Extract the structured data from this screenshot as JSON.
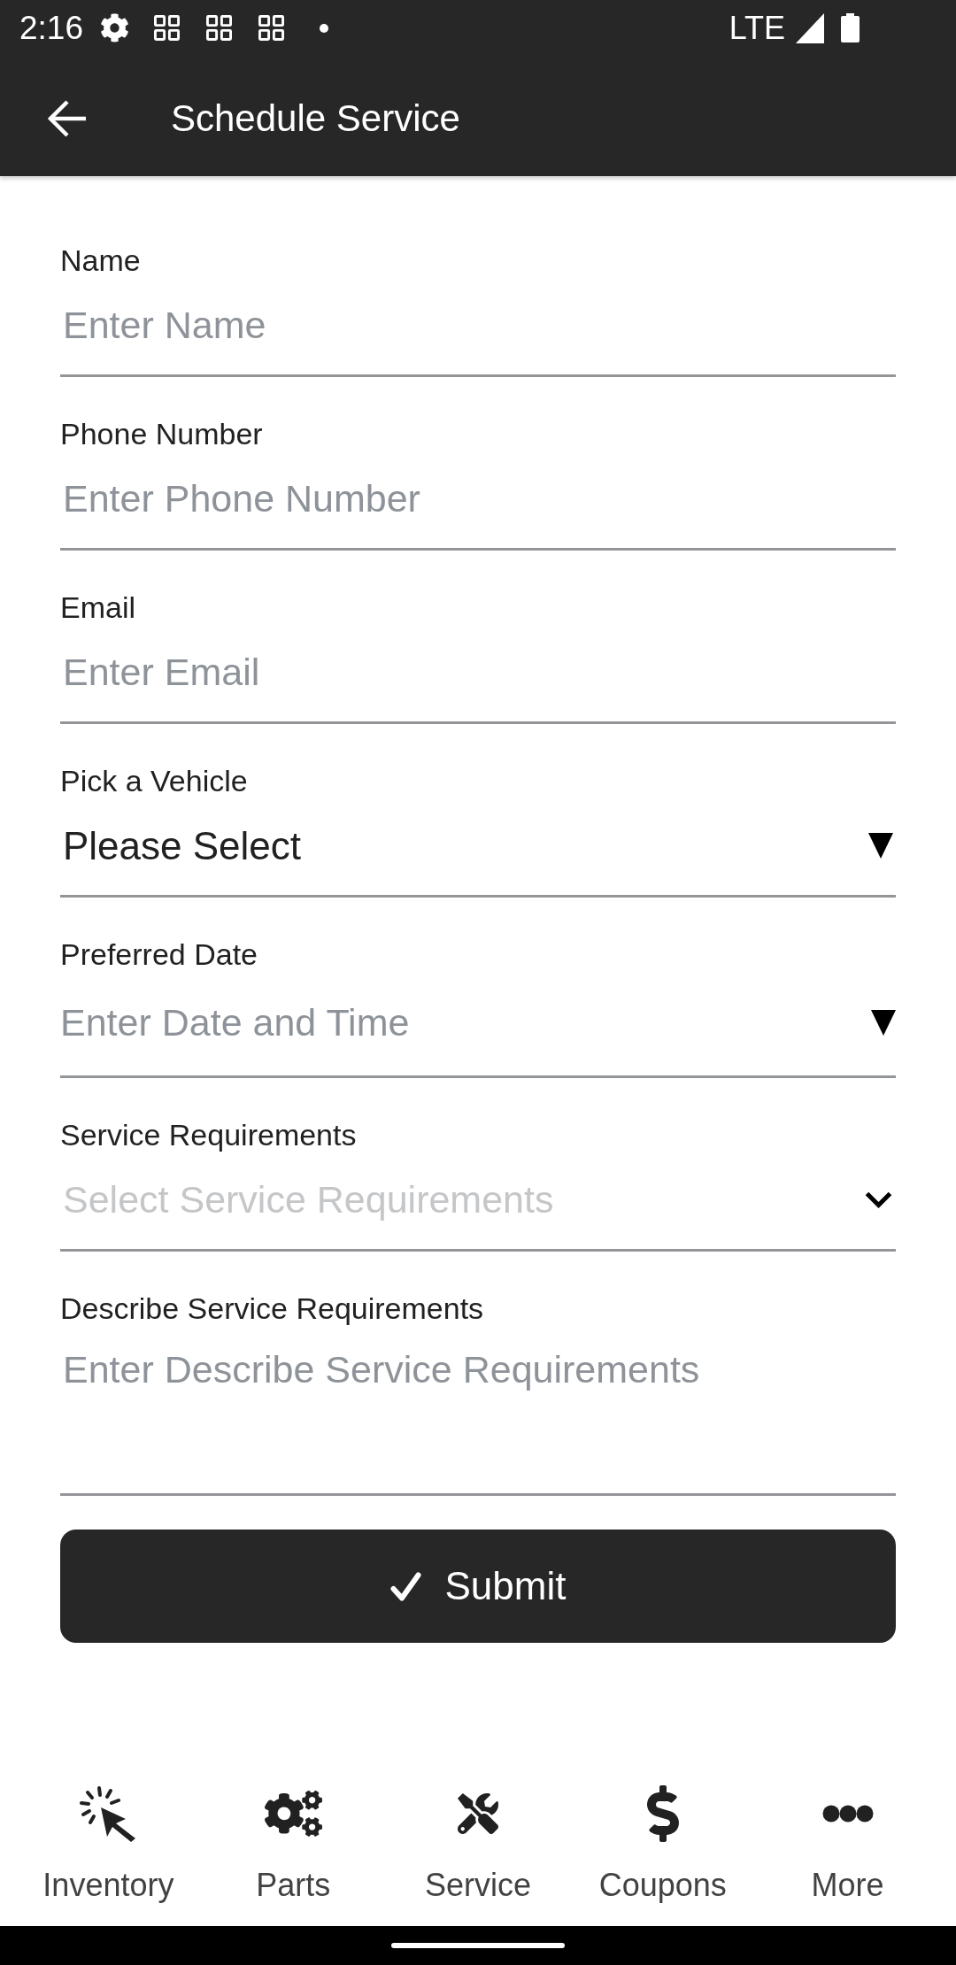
{
  "status_bar": {
    "time": "2:16",
    "network": "LTE"
  },
  "app_bar": {
    "title": "Schedule Service"
  },
  "form": {
    "fields": [
      {
        "kind": "text",
        "label": "Name",
        "placeholder": "Enter Name"
      },
      {
        "kind": "text",
        "label": "Phone Number",
        "placeholder": "Enter Phone Number"
      },
      {
        "kind": "text",
        "label": "Email",
        "placeholder": "Enter Email"
      },
      {
        "kind": "select",
        "label": "Pick a Vehicle",
        "value": "Please Select"
      },
      {
        "kind": "datetime",
        "label": "Preferred Date",
        "placeholder": "Enter Date and Time"
      },
      {
        "kind": "multiselect",
        "label": "Service Requirements",
        "placeholder": "Select Service Requirements"
      },
      {
        "kind": "textarea",
        "label": "Describe Service Requirements",
        "placeholder": "Enter Describe Service Requirements"
      }
    ],
    "submit_button": {
      "label": "Submit"
    }
  },
  "bottom_nav": {
    "items": [
      {
        "label": "Inventory"
      },
      {
        "label": "Parts"
      },
      {
        "label": "Service"
      },
      {
        "label": "Coupons"
      },
      {
        "label": "More"
      }
    ]
  }
}
